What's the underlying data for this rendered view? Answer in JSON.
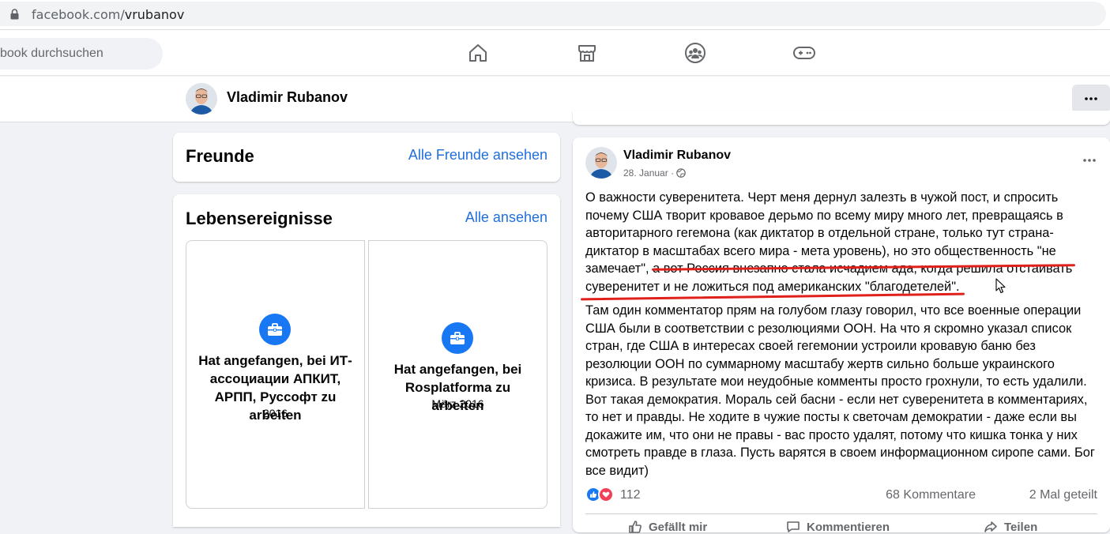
{
  "browser": {
    "url_host": "facebook.com/",
    "url_path": "vrubanov"
  },
  "topnav": {
    "search_placeholder": "book durchsuchen",
    "icons": [
      "home-icon",
      "marketplace-icon",
      "groups-icon",
      "gaming-icon"
    ]
  },
  "profile_bar": {
    "name": "Vladimir Rubanov",
    "more_label": "•••"
  },
  "friends_card": {
    "title": "Freunde",
    "link": "Alle Freunde ansehen"
  },
  "life_events_card": {
    "title": "Lebensereignisse",
    "link": "Alle ansehen",
    "events": [
      {
        "text": "Hat angefangen, bei ИТ-ассоциации АПКИТ, АРПП, Руссофт zu arbeiten",
        "date": "2016"
      },
      {
        "text": "Hat angefangen, bei Rosplatforma zu arbeiten",
        "date": "März 2016"
      }
    ]
  },
  "post": {
    "author": "Vladimir Rubanov",
    "date": "28. Januar",
    "audience_icon": "globe-icon",
    "paragraph1": "О важности суверенитета. Черт меня дернул залезть в чужой пост, и спросить почему США творит кровавое дерьмо по всему миру много лет, превращаясь в авторитарного гегемона (как диктатор в отдельной стране, только тут страна-диктатор в масштабах всего мира - мета уровень), но это общественность \"не замечает\", а вот Россия внезапно стала исчадием ада, когда решила отстаивать суверенитет и не ложиться под американских \"благодетелей\".",
    "paragraph2": "Там один комментатор прям на голубом глазу говорил, что все военные операции США были в соответствии с резолюциями ООН. На что я скромно указал список стран, где США в интересах своей гегемонии устроили кровавую баню без резолюции ООН по суммарному масштабу жертв сильно больше украинского кризиса. В результате мои неудобные комменты просто грохнули, то есть удалили. Вот такая демократия. Мораль сей басни - если нет суверенитета в комментариях, то нет и правды. Не ходите в чужие посты к светочам демократии - даже если вы докажите им, что они не правы - вас просто удалят, потому что кишка тонка у них смотреть правде в глаза. Пусть варятся в своем информационном сиропе сами. Бог все видит)",
    "reactions_count": "112",
    "comments": "68 Kommentare",
    "shares": "2 Mal geteilt",
    "actions": [
      "Gefällt mir",
      "Kommentieren",
      "Teilen"
    ],
    "underline_color": "#e0201b"
  },
  "colors": {
    "accent": "#1877f2",
    "link": "#216fdb",
    "background": "#f0f2f5"
  }
}
